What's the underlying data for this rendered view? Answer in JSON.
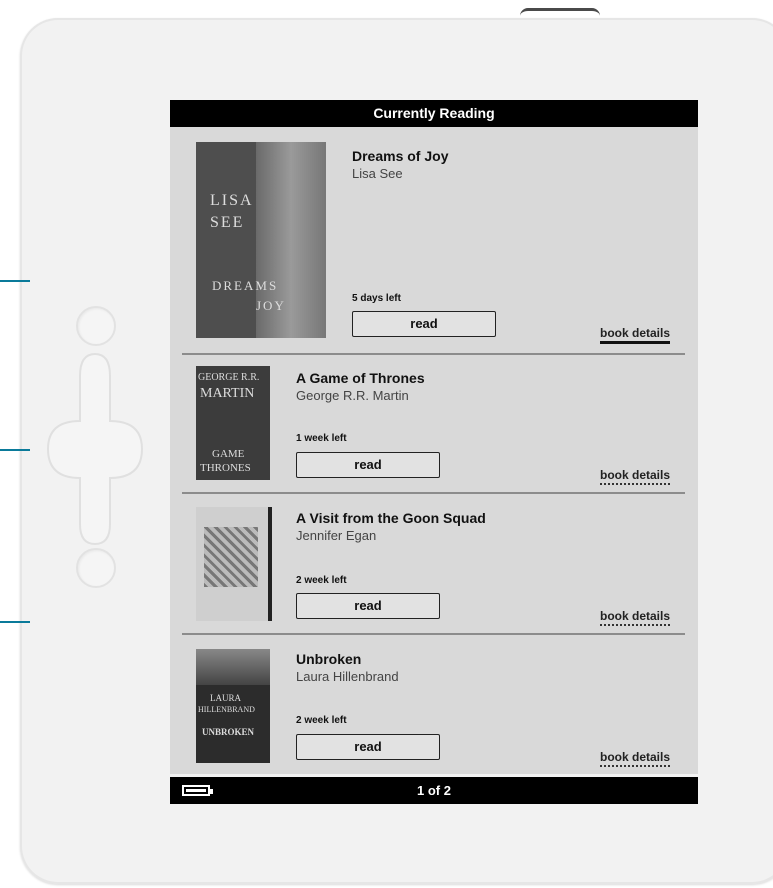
{
  "header": {
    "title": "Currently Reading"
  },
  "footer": {
    "page_indicator": "1 of 2",
    "battery_icon": "battery-icon"
  },
  "books": [
    {
      "title": "Dreams of Joy",
      "author": "Lisa See",
      "time_left": "5 days left",
      "read_label": "read",
      "details_label": "book details",
      "cover_lines": [
        "LISA",
        "SEE",
        "DREAMS",
        "JOY"
      ]
    },
    {
      "title": "A Game of Thrones",
      "author": "George R.R. Martin",
      "time_left": "1 week left",
      "read_label": "read",
      "details_label": "book details",
      "cover_lines": [
        "GEORGE R.R.",
        "MARTIN",
        "GAME",
        "THRONES"
      ]
    },
    {
      "title": "A Visit from the Goon Squad",
      "author": "Jennifer Egan",
      "time_left": "2 week left",
      "read_label": "read",
      "details_label": "book details"
    },
    {
      "title": "Unbroken",
      "author": "Laura Hillenbrand",
      "time_left": "2 week left",
      "read_label": "read",
      "details_label": "book details",
      "cover_lines": [
        "LAURA",
        "HILLENBRAND",
        "UNBROKEN"
      ]
    }
  ],
  "colors": {
    "accent": "#0a7a9a",
    "screen": "#d9d9d9",
    "bar": "#000000"
  }
}
